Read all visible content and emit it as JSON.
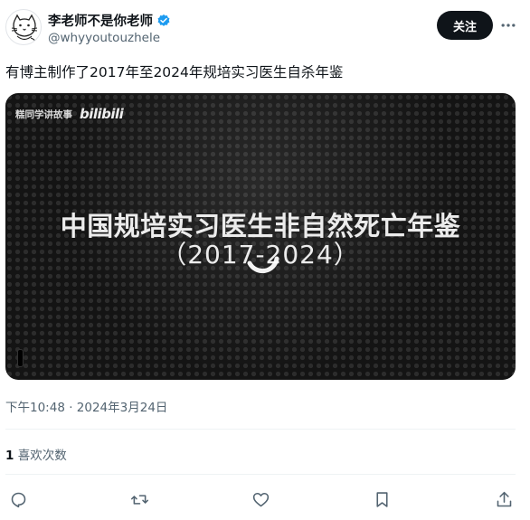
{
  "author": {
    "display_name": "李老师不是你老师",
    "handle": "@whyyoutouzhele",
    "verified": true,
    "avatar_icon": "cat-sketch-avatar"
  },
  "follow_label": "关注",
  "tweet": {
    "text": "有博主制作了2017年至2024年规培实习医生自杀年鉴",
    "timestamp": "下午10:48 · 2024年3月24日",
    "likes_count": "1",
    "likes_label": " 喜欢次数"
  },
  "media": {
    "watermark_text": "糕同学讲故事",
    "watermark_logo": "bilibili",
    "title": "中国规培实习医生非自然死亡年鉴",
    "subtitle": "（2017-2024）"
  },
  "colors": {
    "verified": "#1d9bf0",
    "text_primary": "#0f1419",
    "text_secondary": "#536471"
  },
  "icons": [
    "more-icon",
    "verified-badge-icon",
    "loading-spinner-icon",
    "reply-icon",
    "retweet-icon",
    "like-icon",
    "bookmark-icon",
    "share-icon"
  ]
}
